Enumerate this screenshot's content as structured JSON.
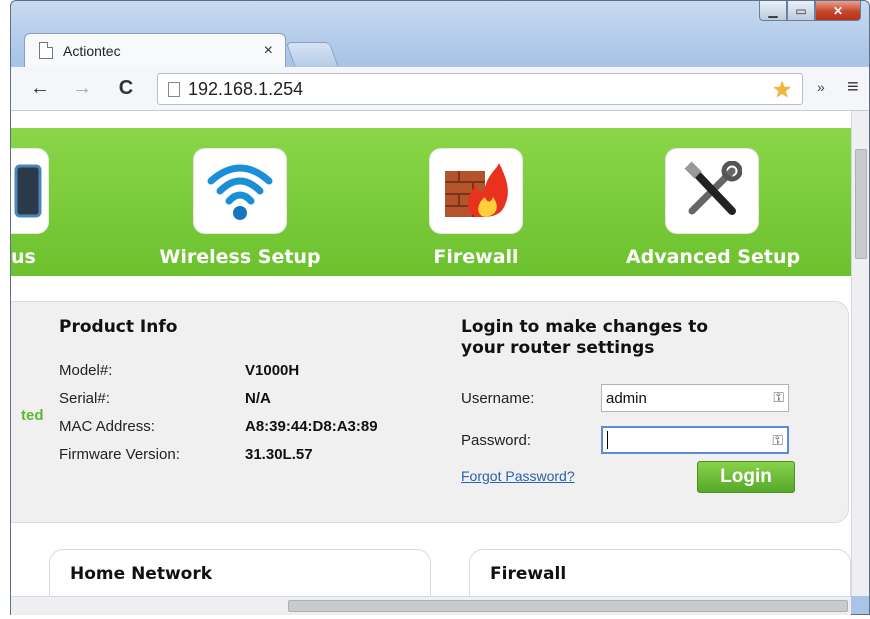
{
  "browser": {
    "tab_title": "Actiontec",
    "tab_close": "×",
    "url": "192.168.1.254",
    "overflow_glyph": "»"
  },
  "nav": {
    "partial_label": "us",
    "items": [
      {
        "label": "Wireless Setup",
        "icon": "wifi-icon"
      },
      {
        "label": "Firewall",
        "icon": "firewall-icon"
      },
      {
        "label": "Advanced Setup",
        "icon": "tools-icon"
      }
    ]
  },
  "product_info": {
    "heading": "Product Info",
    "partial_status": "ted",
    "rows": [
      {
        "label": "Model#:",
        "value": "V1000H"
      },
      {
        "label": "Serial#:",
        "value": "N/A"
      },
      {
        "label": "MAC Address:",
        "value": "A8:39:44:D8:A3:89"
      },
      {
        "label": "Firmware Version:",
        "value": "31.30L.57"
      }
    ]
  },
  "login": {
    "heading_line1": "Login to make changes to",
    "heading_line2": "your router settings",
    "username_label": "Username:",
    "username_value": "admin",
    "password_label": "Password:",
    "password_value": "",
    "forgot_link": "Forgot Password?",
    "login_button": "Login"
  },
  "cards": {
    "home_network": "Home Network",
    "firewall": "Firewall"
  },
  "colors": {
    "banner_green": "#6cc12d",
    "button_green": "#55a92a",
    "link_blue": "#2d5fae"
  }
}
